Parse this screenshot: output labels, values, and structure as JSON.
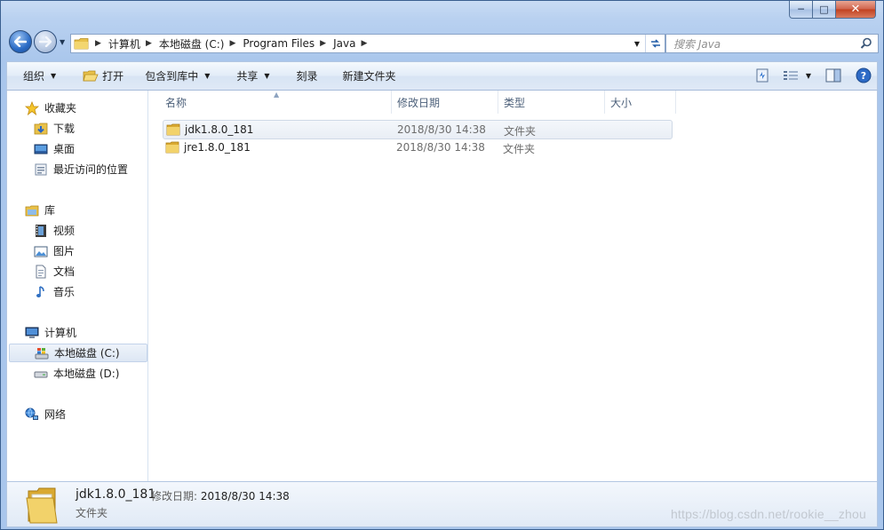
{
  "window": {
    "buttons": {
      "minimize": "─",
      "maximize": "□",
      "close": "✕"
    }
  },
  "nav": {
    "back_icon": "back-arrow-icon",
    "forward_icon": "forward-arrow-icon",
    "recent_dropdown": "▼"
  },
  "address": {
    "crumbs": [
      "计算机",
      "本地磁盘 (C:)",
      "Program Files",
      "Java"
    ],
    "separator": "▶",
    "dropdown": "▼",
    "refresh": "⟲"
  },
  "search": {
    "placeholder": "搜索 Java"
  },
  "toolbar": {
    "organize": "组织",
    "open": "打开",
    "include_in_library": "包含到库中",
    "share": "共享",
    "burn": "刻录",
    "new_folder": "新建文件夹",
    "dropdown": "▼"
  },
  "sidebar": {
    "favorites": {
      "label": "收藏夹",
      "items": [
        "下载",
        "桌面",
        "最近访问的位置"
      ]
    },
    "libraries": {
      "label": "库",
      "items": [
        "视频",
        "图片",
        "文档",
        "音乐"
      ]
    },
    "computer": {
      "label": "计算机",
      "items": [
        "本地磁盘 (C:)",
        "本地磁盘 (D:)"
      ],
      "selected": "本地磁盘 (C:)"
    },
    "network": {
      "label": "网络"
    }
  },
  "columns": [
    "名称",
    "修改日期",
    "类型",
    "大小"
  ],
  "files": [
    {
      "name": "jdk1.8.0_181",
      "modified": "2018/8/30 14:38",
      "type": "文件夹",
      "size": ""
    },
    {
      "name": "jre1.8.0_181",
      "modified": "2018/8/30 14:38",
      "type": "文件夹",
      "size": ""
    }
  ],
  "details": {
    "name": "jdk1.8.0_181",
    "modified_label": "修改日期:",
    "modified_value": "2018/8/30 14:38",
    "type": "文件夹"
  },
  "watermark": "https://blog.csdn.net/rookie__zhou",
  "colors": {
    "title_gradient_top": "#c9dcf4",
    "folder_yellow": "#e8c14a",
    "selection": "#dde7f4"
  }
}
